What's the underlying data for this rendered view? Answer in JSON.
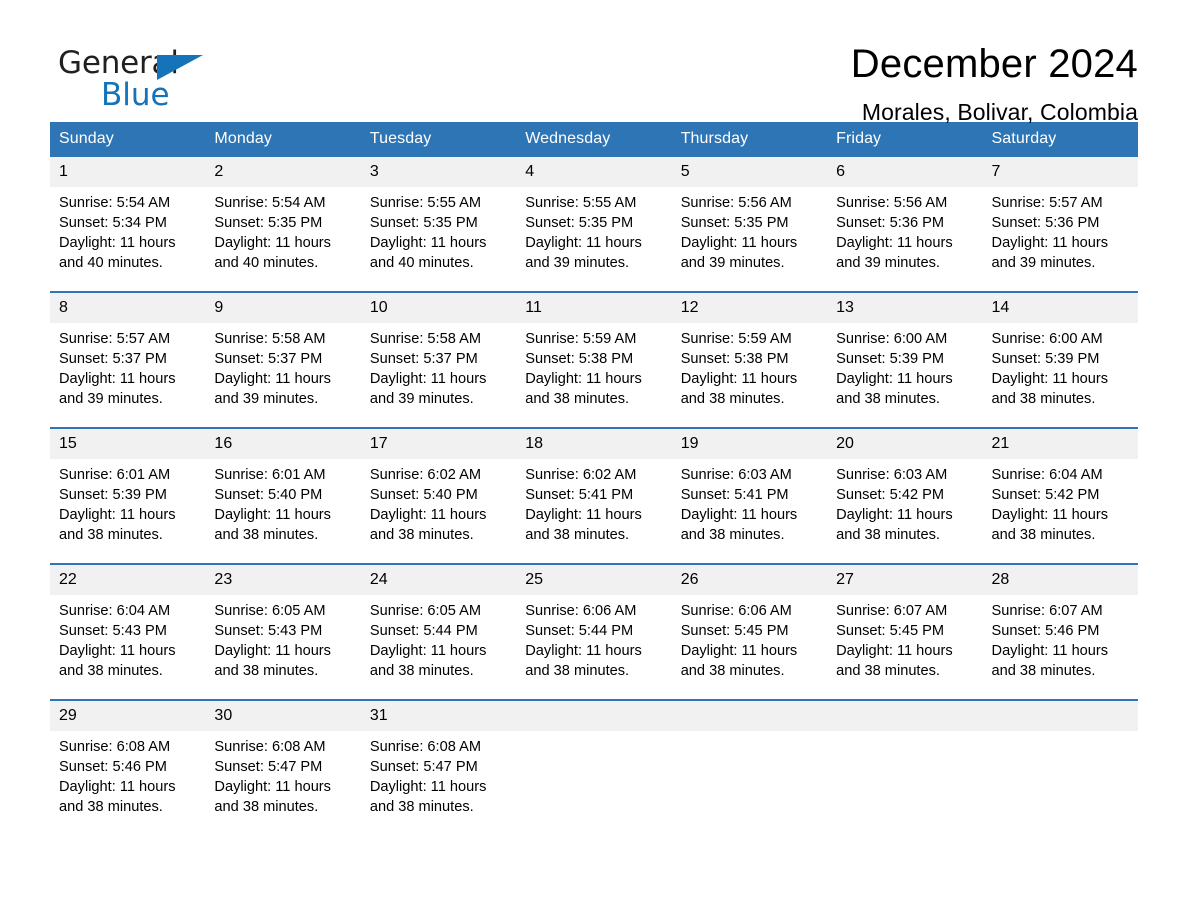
{
  "brand": {
    "name_part1": "General",
    "name_part2": "Blue",
    "logo_icon": "triangle-flag-icon",
    "accent_color": "#1573ba"
  },
  "header": {
    "title": "December 2024",
    "location": "Morales, Bolivar, Colombia"
  },
  "calendar": {
    "header_bg": "#2e75b6",
    "row_bg": "#f1f1f1",
    "weekdays": [
      "Sunday",
      "Monday",
      "Tuesday",
      "Wednesday",
      "Thursday",
      "Friday",
      "Saturday"
    ],
    "weeks": [
      [
        {
          "day": "1",
          "sunrise": "Sunrise: 5:54 AM",
          "sunset": "Sunset: 5:34 PM",
          "daylight_line1": "Daylight: 11 hours",
          "daylight_line2": "and 40 minutes."
        },
        {
          "day": "2",
          "sunrise": "Sunrise: 5:54 AM",
          "sunset": "Sunset: 5:35 PM",
          "daylight_line1": "Daylight: 11 hours",
          "daylight_line2": "and 40 minutes."
        },
        {
          "day": "3",
          "sunrise": "Sunrise: 5:55 AM",
          "sunset": "Sunset: 5:35 PM",
          "daylight_line1": "Daylight: 11 hours",
          "daylight_line2": "and 40 minutes."
        },
        {
          "day": "4",
          "sunrise": "Sunrise: 5:55 AM",
          "sunset": "Sunset: 5:35 PM",
          "daylight_line1": "Daylight: 11 hours",
          "daylight_line2": "and 39 minutes."
        },
        {
          "day": "5",
          "sunrise": "Sunrise: 5:56 AM",
          "sunset": "Sunset: 5:35 PM",
          "daylight_line1": "Daylight: 11 hours",
          "daylight_line2": "and 39 minutes."
        },
        {
          "day": "6",
          "sunrise": "Sunrise: 5:56 AM",
          "sunset": "Sunset: 5:36 PM",
          "daylight_line1": "Daylight: 11 hours",
          "daylight_line2": "and 39 minutes."
        },
        {
          "day": "7",
          "sunrise": "Sunrise: 5:57 AM",
          "sunset": "Sunset: 5:36 PM",
          "daylight_line1": "Daylight: 11 hours",
          "daylight_line2": "and 39 minutes."
        }
      ],
      [
        {
          "day": "8",
          "sunrise": "Sunrise: 5:57 AM",
          "sunset": "Sunset: 5:37 PM",
          "daylight_line1": "Daylight: 11 hours",
          "daylight_line2": "and 39 minutes."
        },
        {
          "day": "9",
          "sunrise": "Sunrise: 5:58 AM",
          "sunset": "Sunset: 5:37 PM",
          "daylight_line1": "Daylight: 11 hours",
          "daylight_line2": "and 39 minutes."
        },
        {
          "day": "10",
          "sunrise": "Sunrise: 5:58 AM",
          "sunset": "Sunset: 5:37 PM",
          "daylight_line1": "Daylight: 11 hours",
          "daylight_line2": "and 39 minutes."
        },
        {
          "day": "11",
          "sunrise": "Sunrise: 5:59 AM",
          "sunset": "Sunset: 5:38 PM",
          "daylight_line1": "Daylight: 11 hours",
          "daylight_line2": "and 38 minutes."
        },
        {
          "day": "12",
          "sunrise": "Sunrise: 5:59 AM",
          "sunset": "Sunset: 5:38 PM",
          "daylight_line1": "Daylight: 11 hours",
          "daylight_line2": "and 38 minutes."
        },
        {
          "day": "13",
          "sunrise": "Sunrise: 6:00 AM",
          "sunset": "Sunset: 5:39 PM",
          "daylight_line1": "Daylight: 11 hours",
          "daylight_line2": "and 38 minutes."
        },
        {
          "day": "14",
          "sunrise": "Sunrise: 6:00 AM",
          "sunset": "Sunset: 5:39 PM",
          "daylight_line1": "Daylight: 11 hours",
          "daylight_line2": "and 38 minutes."
        }
      ],
      [
        {
          "day": "15",
          "sunrise": "Sunrise: 6:01 AM",
          "sunset": "Sunset: 5:39 PM",
          "daylight_line1": "Daylight: 11 hours",
          "daylight_line2": "and 38 minutes."
        },
        {
          "day": "16",
          "sunrise": "Sunrise: 6:01 AM",
          "sunset": "Sunset: 5:40 PM",
          "daylight_line1": "Daylight: 11 hours",
          "daylight_line2": "and 38 minutes."
        },
        {
          "day": "17",
          "sunrise": "Sunrise: 6:02 AM",
          "sunset": "Sunset: 5:40 PM",
          "daylight_line1": "Daylight: 11 hours",
          "daylight_line2": "and 38 minutes."
        },
        {
          "day": "18",
          "sunrise": "Sunrise: 6:02 AM",
          "sunset": "Sunset: 5:41 PM",
          "daylight_line1": "Daylight: 11 hours",
          "daylight_line2": "and 38 minutes."
        },
        {
          "day": "19",
          "sunrise": "Sunrise: 6:03 AM",
          "sunset": "Sunset: 5:41 PM",
          "daylight_line1": "Daylight: 11 hours",
          "daylight_line2": "and 38 minutes."
        },
        {
          "day": "20",
          "sunrise": "Sunrise: 6:03 AM",
          "sunset": "Sunset: 5:42 PM",
          "daylight_line1": "Daylight: 11 hours",
          "daylight_line2": "and 38 minutes."
        },
        {
          "day": "21",
          "sunrise": "Sunrise: 6:04 AM",
          "sunset": "Sunset: 5:42 PM",
          "daylight_line1": "Daylight: 11 hours",
          "daylight_line2": "and 38 minutes."
        }
      ],
      [
        {
          "day": "22",
          "sunrise": "Sunrise: 6:04 AM",
          "sunset": "Sunset: 5:43 PM",
          "daylight_line1": "Daylight: 11 hours",
          "daylight_line2": "and 38 minutes."
        },
        {
          "day": "23",
          "sunrise": "Sunrise: 6:05 AM",
          "sunset": "Sunset: 5:43 PM",
          "daylight_line1": "Daylight: 11 hours",
          "daylight_line2": "and 38 minutes."
        },
        {
          "day": "24",
          "sunrise": "Sunrise: 6:05 AM",
          "sunset": "Sunset: 5:44 PM",
          "daylight_line1": "Daylight: 11 hours",
          "daylight_line2": "and 38 minutes."
        },
        {
          "day": "25",
          "sunrise": "Sunrise: 6:06 AM",
          "sunset": "Sunset: 5:44 PM",
          "daylight_line1": "Daylight: 11 hours",
          "daylight_line2": "and 38 minutes."
        },
        {
          "day": "26",
          "sunrise": "Sunrise: 6:06 AM",
          "sunset": "Sunset: 5:45 PM",
          "daylight_line1": "Daylight: 11 hours",
          "daylight_line2": "and 38 minutes."
        },
        {
          "day": "27",
          "sunrise": "Sunrise: 6:07 AM",
          "sunset": "Sunset: 5:45 PM",
          "daylight_line1": "Daylight: 11 hours",
          "daylight_line2": "and 38 minutes."
        },
        {
          "day": "28",
          "sunrise": "Sunrise: 6:07 AM",
          "sunset": "Sunset: 5:46 PM",
          "daylight_line1": "Daylight: 11 hours",
          "daylight_line2": "and 38 minutes."
        }
      ],
      [
        {
          "day": "29",
          "sunrise": "Sunrise: 6:08 AM",
          "sunset": "Sunset: 5:46 PM",
          "daylight_line1": "Daylight: 11 hours",
          "daylight_line2": "and 38 minutes."
        },
        {
          "day": "30",
          "sunrise": "Sunrise: 6:08 AM",
          "sunset": "Sunset: 5:47 PM",
          "daylight_line1": "Daylight: 11 hours",
          "daylight_line2": "and 38 minutes."
        },
        {
          "day": "31",
          "sunrise": "Sunrise: 6:08 AM",
          "sunset": "Sunset: 5:47 PM",
          "daylight_line1": "Daylight: 11 hours",
          "daylight_line2": "and 38 minutes."
        },
        {
          "day": "",
          "sunrise": "",
          "sunset": "",
          "daylight_line1": "",
          "daylight_line2": ""
        },
        {
          "day": "",
          "sunrise": "",
          "sunset": "",
          "daylight_line1": "",
          "daylight_line2": ""
        },
        {
          "day": "",
          "sunrise": "",
          "sunset": "",
          "daylight_line1": "",
          "daylight_line2": ""
        },
        {
          "day": "",
          "sunrise": "",
          "sunset": "",
          "daylight_line1": "",
          "daylight_line2": ""
        }
      ]
    ]
  }
}
